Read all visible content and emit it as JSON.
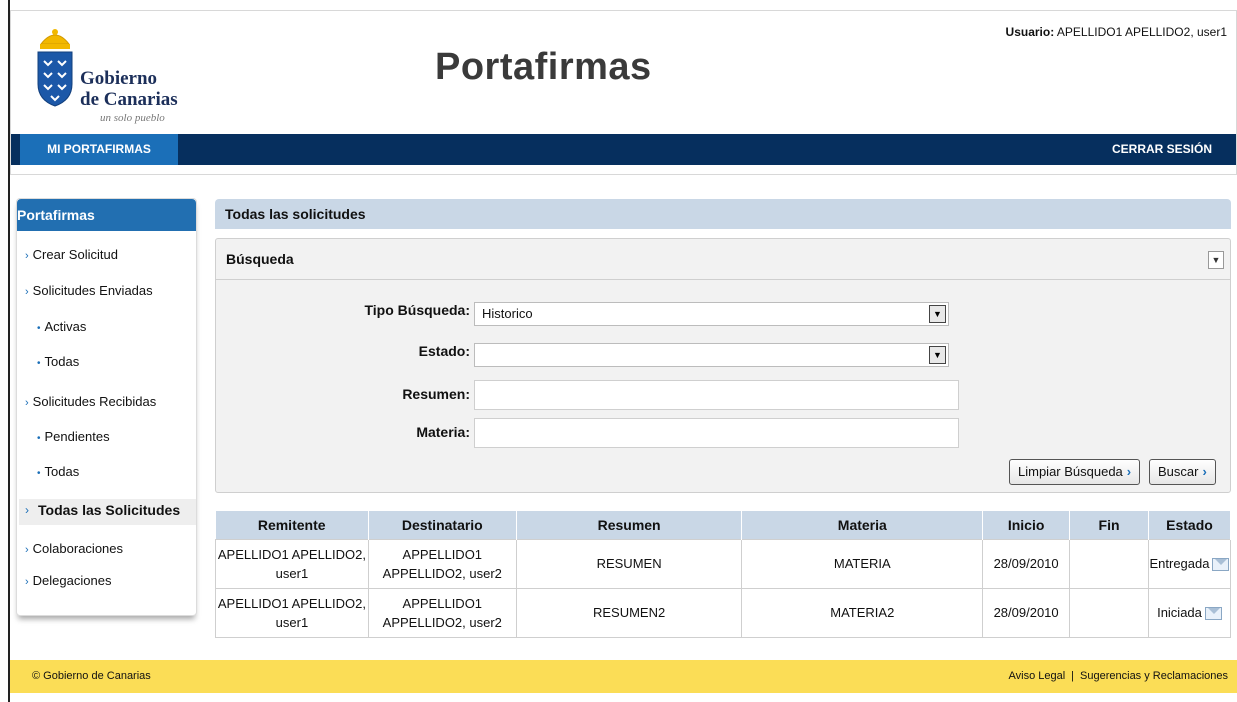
{
  "header": {
    "logo_line1": "Gobierno",
    "logo_line2": "de Canarias",
    "logo_tagline": "un solo pueblo",
    "app_title": "Portafirmas",
    "user_label": "Usuario:",
    "user_value": " APELLIDO1 APELLIDO2, user1"
  },
  "nav": {
    "tab": "MI PORTAFIRMAS",
    "logout": "CERRAR SESIÓN"
  },
  "sidebar": {
    "title": "Portafirmas",
    "crear": "Crear Solicitud",
    "enviadas": "Solicitudes Enviadas",
    "enviadas_activas": "Activas",
    "enviadas_todas": "Todas",
    "recibidas": "Solicitudes Recibidas",
    "recibidas_pendientes": "Pendientes",
    "recibidas_todas": "Todas",
    "todas": "Todas las Solicitudes",
    "colaboraciones": "Colaboraciones",
    "delegaciones": "Delegaciones"
  },
  "content": {
    "title": "Todas las solicitudes"
  },
  "search": {
    "title": "Búsqueda",
    "tipo_label": "Tipo Búsqueda:",
    "tipo_value": "Historico",
    "estado_label": "Estado:",
    "estado_value": "",
    "resumen_label": "Resumen:",
    "materia_label": "Materia:",
    "clear_label": "Limpiar Búsqueda",
    "search_label": "Buscar"
  },
  "table": {
    "headers": [
      "Remitente",
      "Destinatario",
      "Resumen",
      "Materia",
      "Inicio",
      "Fin",
      "Estado"
    ],
    "rows": [
      {
        "remitente_1": "APELLIDO1 APELLIDO2,",
        "remitente_2": "user1",
        "destinatario_1": "APPELLIDO1",
        "destinatario_2": "APPELLIDO2, user2",
        "resumen": "RESUMEN",
        "materia": "MATERIA",
        "inicio": "28/09/2010",
        "fin": "",
        "estado": "Entregada",
        "icon": "envelope-sent-icon"
      },
      {
        "remitente_1": "APELLIDO1 APELLIDO2,",
        "remitente_2": "user1",
        "destinatario_1": "APPELLIDO1",
        "destinatario_2": "APPELLIDO2, user2",
        "resumen": "RESUMEN2",
        "materia": "MATERIA2",
        "inicio": "28/09/2010",
        "fin": "",
        "estado": "Iniciada",
        "icon": "envelope-edit-icon"
      }
    ]
  },
  "footer": {
    "copyright": "© Gobierno de Canarias",
    "aviso": "Aviso Legal",
    "separator": "|",
    "sugerencias": "Sugerencias y Reclamaciones"
  },
  "colors": {
    "navbar": "#062f5e",
    "accent": "#1b6fb8",
    "panel_header": "#c9d7e6",
    "footer": "#fbdd56"
  }
}
